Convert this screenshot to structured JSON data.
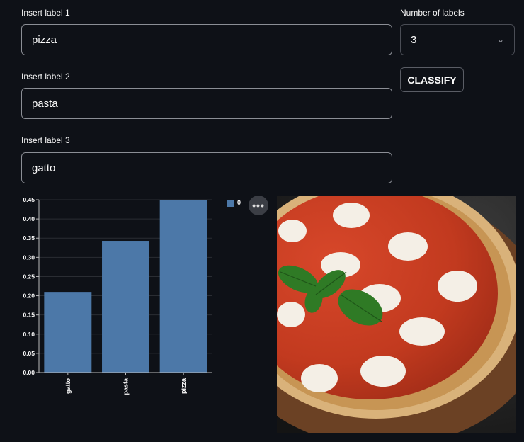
{
  "fields": [
    {
      "label": "Insert label 1",
      "value": "pizza"
    },
    {
      "label": "Insert label 2",
      "value": "pasta"
    },
    {
      "label": "Insert label 3",
      "value": "gatto"
    }
  ],
  "num_labels": {
    "label": "Number of labels",
    "value": "3"
  },
  "classify_label": "CLASSIFY",
  "more_icon": "ellipsis-icon",
  "image_subject": "pizza-photo",
  "chart_data": {
    "type": "bar",
    "categories": [
      "gatto",
      "pasta",
      "pizza"
    ],
    "series": [
      {
        "name": "0",
        "values": [
          0.21,
          0.343,
          0.45
        ]
      }
    ],
    "ylim": [
      0,
      0.45
    ],
    "yticks": [
      "0.00",
      "0.05",
      "0.10",
      "0.15",
      "0.20",
      "0.25",
      "0.30",
      "0.35",
      "0.40",
      "0.45"
    ],
    "legend": "top-right",
    "grid": true,
    "color": "#4c78a8"
  }
}
